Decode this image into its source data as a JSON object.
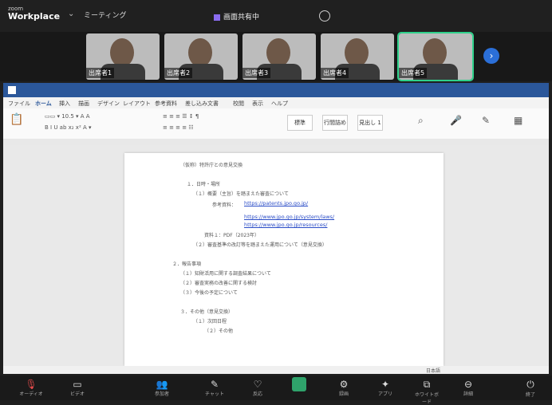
{
  "topbar": {
    "brand_small": "zoom",
    "brand": "Workplace",
    "meeting_tab": "ミーティング",
    "sharing_label": "画面共有中"
  },
  "gallery": {
    "participants": [
      {
        "name": "出席者1"
      },
      {
        "name": "出席者2"
      },
      {
        "name": "出席者3"
      },
      {
        "name": "出席者4"
      },
      {
        "name": "出席者5"
      }
    ]
  },
  "word": {
    "menus": [
      "ファイル",
      "ホーム",
      "挿入",
      "描画",
      "デザイン",
      "レイアウト",
      "参考資料",
      "差し込み文書",
      "校閲",
      "表示",
      "ヘルプ"
    ],
    "styles": [
      "標準",
      "行間詰め",
      "見出し 1"
    ],
    "document": {
      "lines": [
        "（仮称）特許庁との意見交換",
        "",
        "１．日時・場所",
        "（１）概要（主旨）を踏まえた審査について",
        "参考資料：",
        "",
        "",
        "",
        "資料１：PDF（2023年）",
        "（２）審査基準の改訂等を踏まえた運用について（意見交換）",
        "",
        "２．報告事項",
        "（１）知財活用に関する調査結果について",
        "（２）審査実務の改善に関する検討",
        "（３）今後の予定について",
        "",
        "３．その他（意見交換）",
        "（１）次回日程",
        "（２）その他"
      ],
      "links": [
        "https://patents.jpo.go.jp/",
        "https://www.jpo.go.jp/system/laws/",
        "https://www.jpo.go.jp/resources/"
      ]
    },
    "status": "日本語"
  },
  "toolbar": {
    "items": [
      "オーディオ",
      "ビデオ",
      "参加者",
      "チャット",
      "反応",
      "共有",
      "録画",
      "アプリ",
      "ホワイトボード",
      "詳細",
      "終了"
    ]
  },
  "colors": {
    "accent": "#2b579a",
    "active_tile": "#2fd18b",
    "share": "#2fa36b"
  }
}
